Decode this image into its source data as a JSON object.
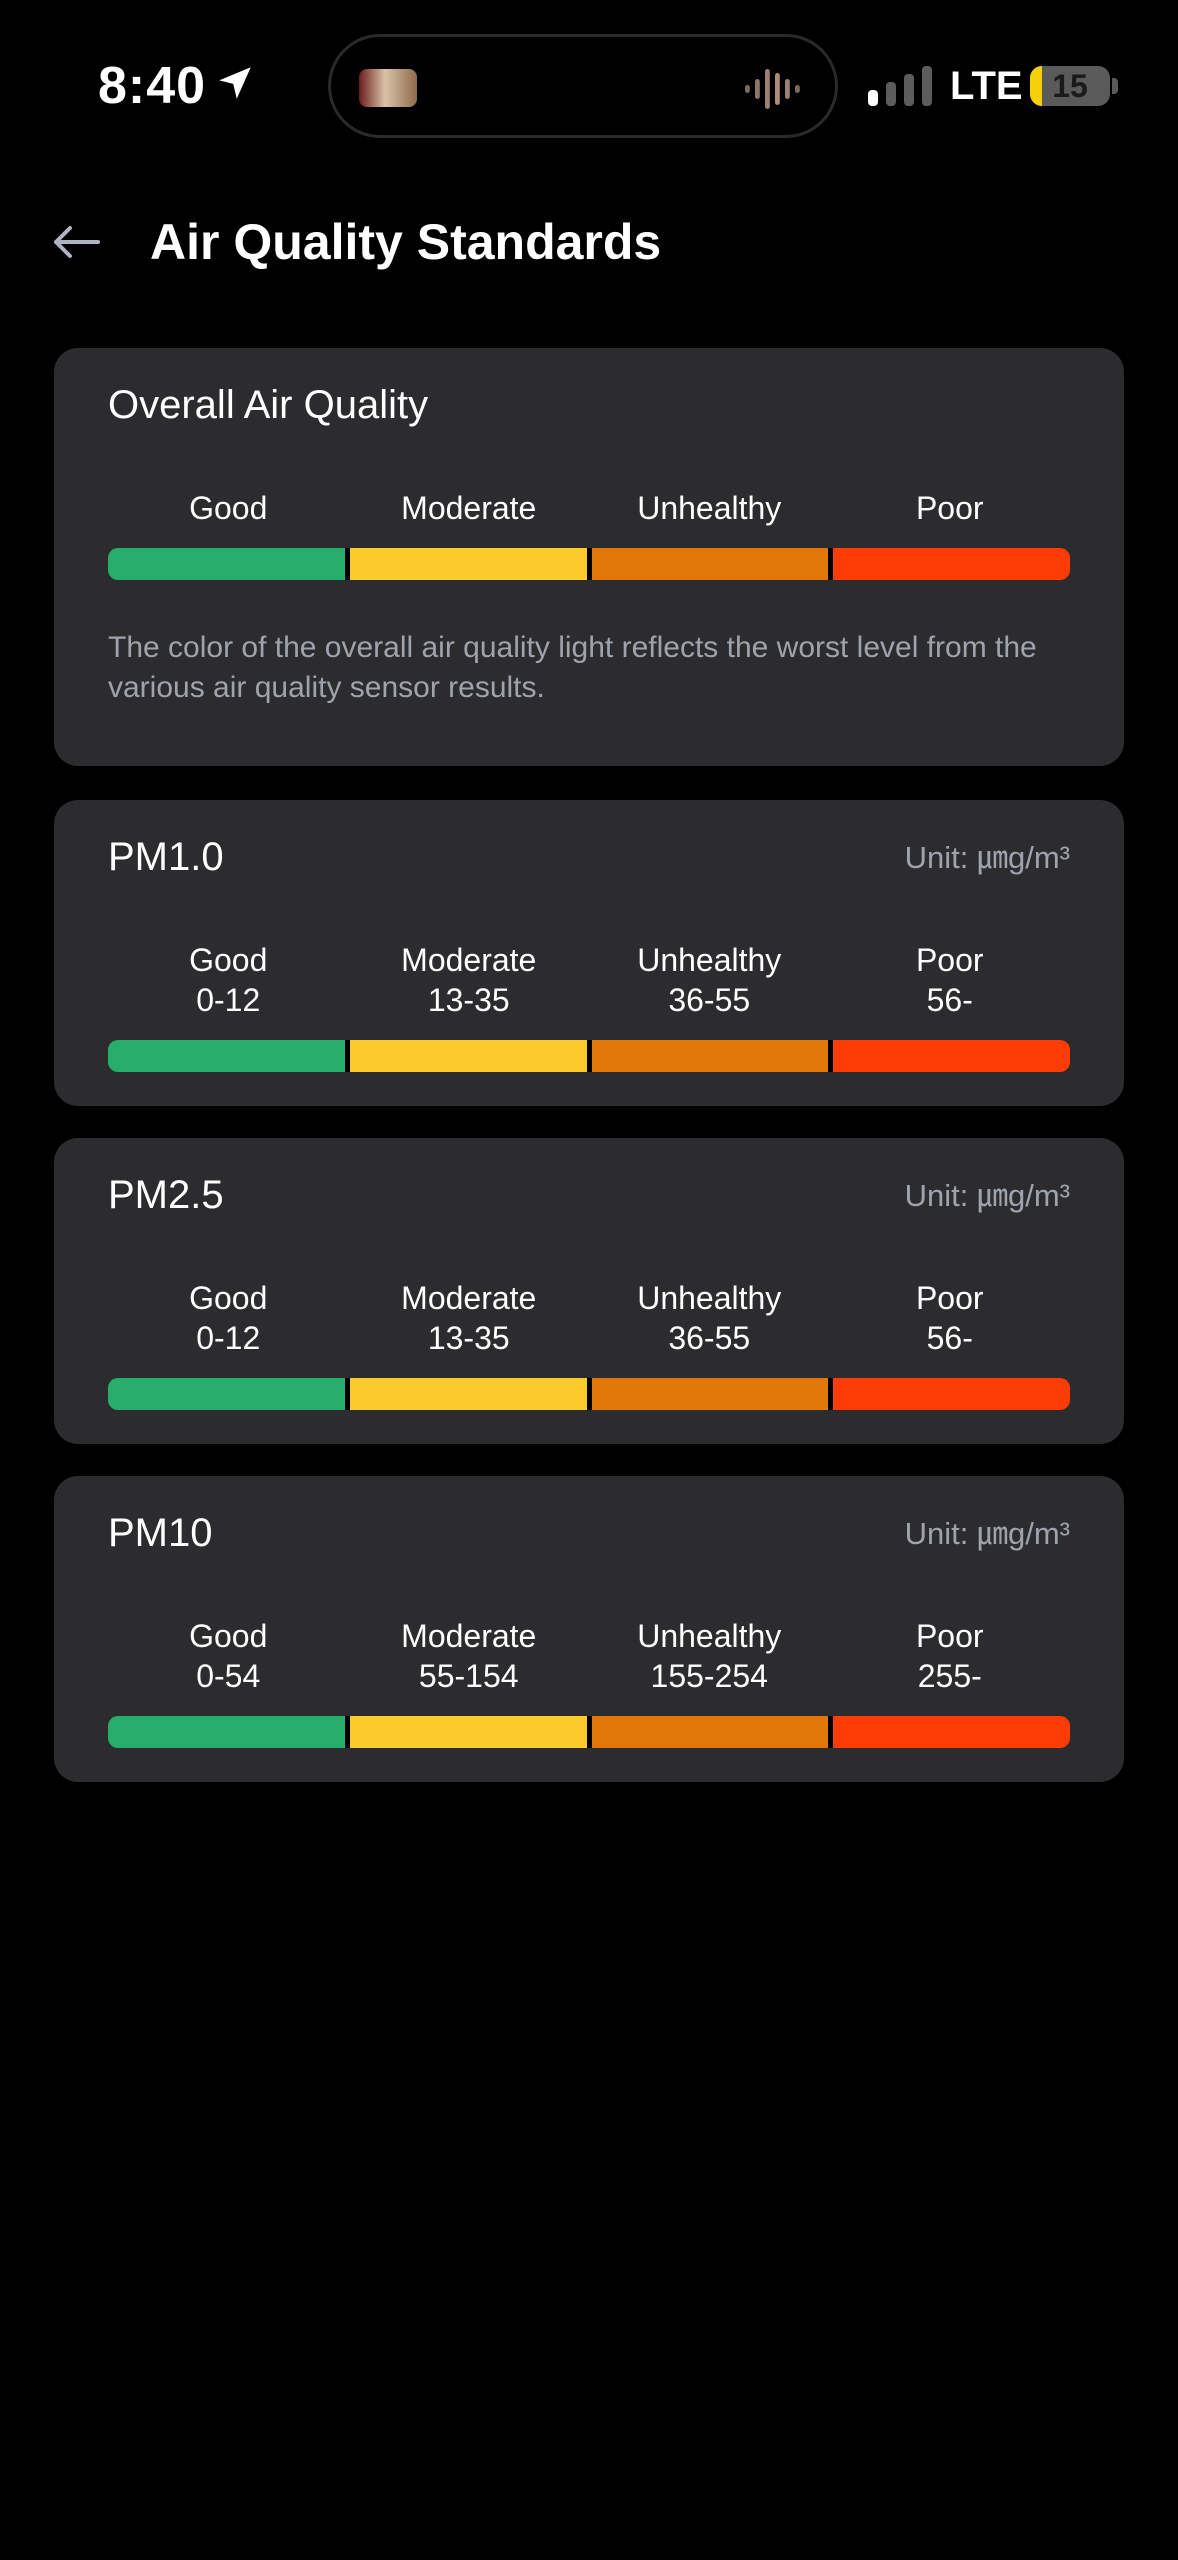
{
  "status_bar": {
    "time": "8:40",
    "network": "LTE",
    "battery_level": "15",
    "battery_fraction": 0.15,
    "icons": [
      "location-arrow-icon",
      "signal-icon",
      "battery-icon",
      "audio-wave-icon"
    ]
  },
  "header": {
    "back_icon": "arrow-left-icon",
    "title": "Air Quality Standards"
  },
  "colors": {
    "good": "#27ae6b",
    "moderate": "#fbcb2d",
    "unhealthy": "#e07708",
    "poor": "#fd3b05",
    "card_bg": "#2c2c2e",
    "muted_text": "#9ea3ad"
  },
  "overall": {
    "title": "Overall Air Quality",
    "levels": [
      "Good",
      "Moderate",
      "Unhealthy",
      "Poor"
    ],
    "note": "The color of the overall air quality light reflects the worst level from the various air quality sensor results."
  },
  "sensors": [
    {
      "title": "PM1.0",
      "unit": "Unit: ㎛g/m³",
      "levels": [
        {
          "label": "Good",
          "range": "0-12"
        },
        {
          "label": "Moderate",
          "range": "13-35"
        },
        {
          "label": "Unhealthy",
          "range": "36-55"
        },
        {
          "label": "Poor",
          "range": "56-"
        }
      ]
    },
    {
      "title": "PM2.5",
      "unit": "Unit: ㎛g/m³",
      "levels": [
        {
          "label": "Good",
          "range": "0-12"
        },
        {
          "label": "Moderate",
          "range": "13-35"
        },
        {
          "label": "Unhealthy",
          "range": "36-55"
        },
        {
          "label": "Poor",
          "range": "56-"
        }
      ]
    },
    {
      "title": "PM10",
      "unit": "Unit: ㎛g/m³",
      "levels": [
        {
          "label": "Good",
          "range": "0-54"
        },
        {
          "label": "Moderate",
          "range": "55-154"
        },
        {
          "label": "Unhealthy",
          "range": "155-254"
        },
        {
          "label": "Poor",
          "range": "255-"
        }
      ]
    }
  ]
}
